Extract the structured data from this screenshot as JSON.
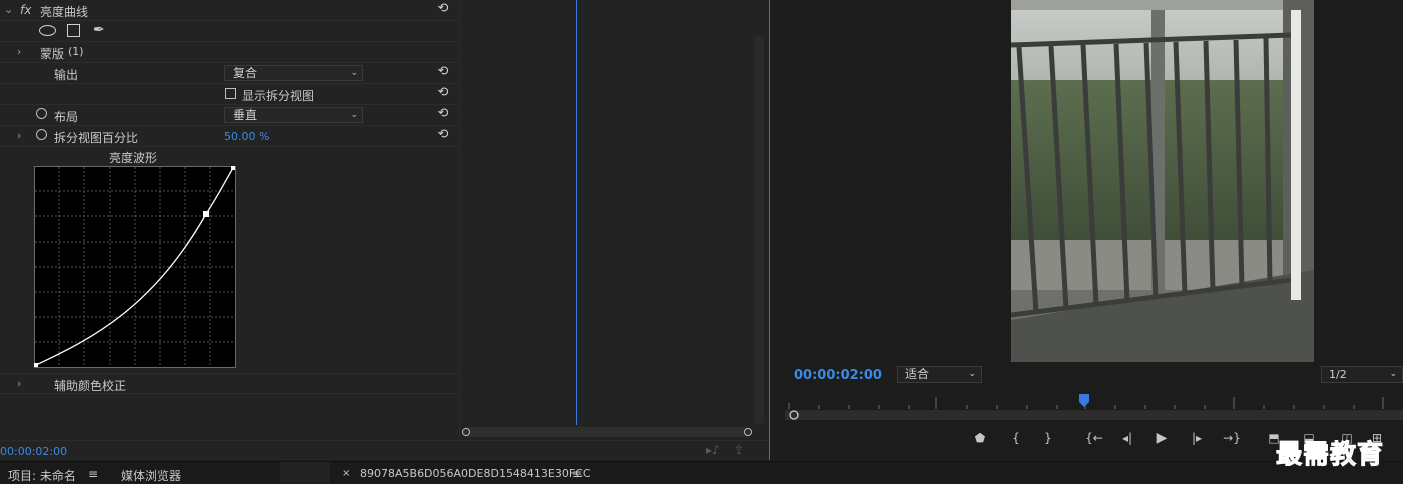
{
  "effect_controls": {
    "effect_name": "亮度曲线",
    "fx_label": "fx",
    "mask_label": "蒙版",
    "mask_count": "(1)",
    "output_label": "输出",
    "output_value": "复合",
    "split_view_checkbox": "显示拆分视图",
    "layout_label": "布局",
    "layout_value": "垂直",
    "split_percent_label": "拆分视图百分比",
    "split_percent_value": "50.00 %",
    "waveform_title": "亮度波形",
    "secondary_color_label": "辅助颜色校正",
    "timecode": "00:00:02:00"
  },
  "program_monitor": {
    "timecode": "00:00:02:00",
    "fit_value": "适合",
    "resolution_value": "1/2",
    "playhead_position": 0.485
  },
  "tabs": {
    "project": "项目: 未命名",
    "media_browser": "媒体浏览器",
    "sequence": "89078A5B6D056A0DE8D1548413E30FCC"
  },
  "icons": {
    "reset": "reset-icon",
    "ellipse": "ellipse-mask-icon",
    "rect": "rectangle-mask-icon",
    "pen": "pen-mask-icon",
    "stopwatch": "stopwatch-icon"
  },
  "colors": {
    "accent": "#3a7be0",
    "timecode": "#3a8be6",
    "watermark": "#1a2fc8"
  },
  "watermark": "最需教育"
}
